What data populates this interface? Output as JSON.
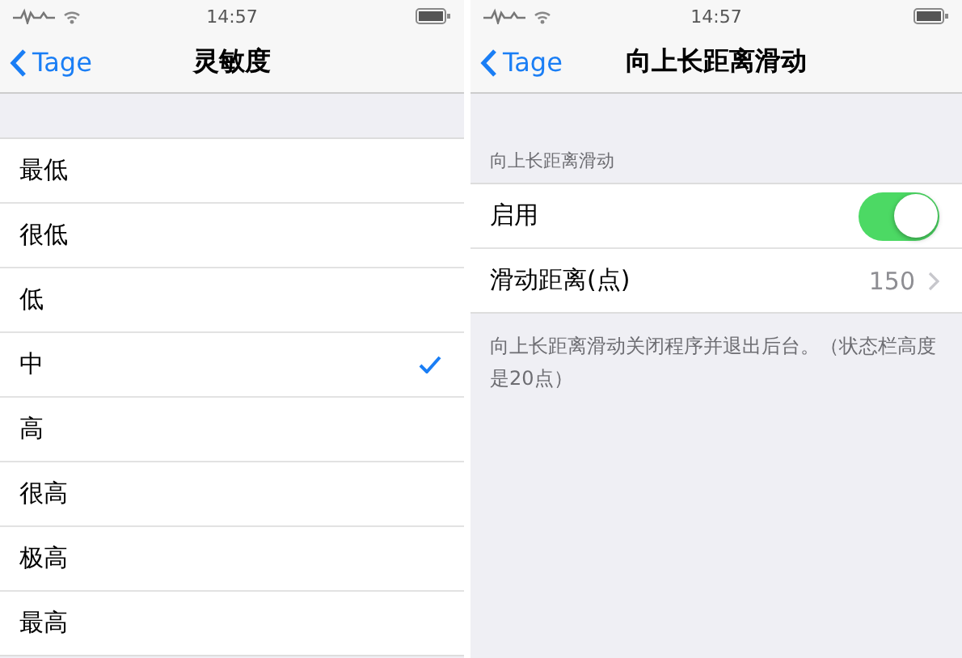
{
  "screens": [
    {
      "status_bar": {
        "time": "14:57"
      },
      "nav": {
        "back": "Tage",
        "title": "灵敏度"
      },
      "options": [
        {
          "label": "最低",
          "selected": false
        },
        {
          "label": "很低",
          "selected": false
        },
        {
          "label": "低",
          "selected": false
        },
        {
          "label": "中",
          "selected": true
        },
        {
          "label": "高",
          "selected": false
        },
        {
          "label": "很高",
          "selected": false
        },
        {
          "label": "极高",
          "selected": false
        },
        {
          "label": "最高",
          "selected": false
        }
      ]
    },
    {
      "status_bar": {
        "time": "14:57"
      },
      "nav": {
        "back": "Tage",
        "title": "向上长距离滑动"
      },
      "section_header": "向上长距离滑动",
      "rows": [
        {
          "kind": "toggle",
          "label": "启用",
          "on": true
        },
        {
          "kind": "disclosure",
          "label": "滑动距离(点)",
          "value": "150"
        }
      ],
      "footer": "向上长距离滑动关闭程序并退出后台。（状态栏高度是20点）"
    }
  ]
}
